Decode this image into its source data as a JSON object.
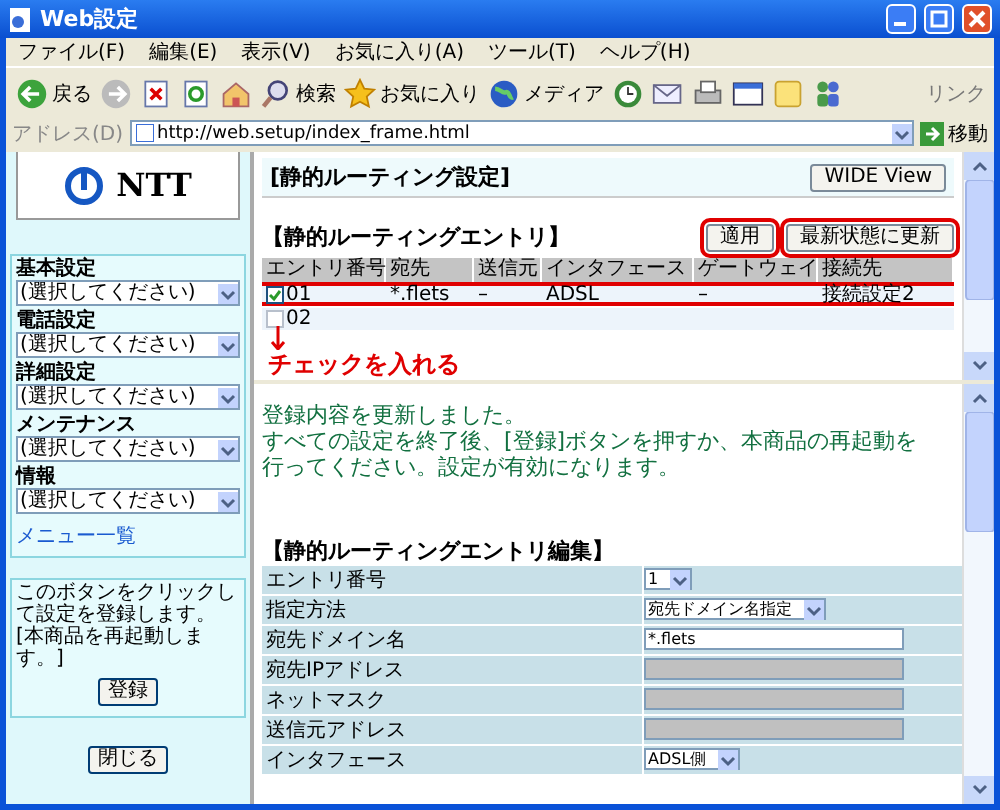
{
  "window": {
    "title": "Web設定"
  },
  "menu": [
    "ファイル(F)",
    "編集(E)",
    "表示(V)",
    "お気に入り(A)",
    "ツール(T)",
    "ヘルプ(H)"
  ],
  "toolbar": [
    {
      "kind": "back",
      "label": "戻る"
    },
    {
      "kind": "forward"
    },
    {
      "kind": "stop"
    },
    {
      "kind": "refresh"
    },
    {
      "kind": "home"
    },
    {
      "kind": "search",
      "label": "検索"
    },
    {
      "kind": "favorites",
      "label": "お気に入り"
    },
    {
      "kind": "media",
      "label": "メディア"
    },
    {
      "kind": "history"
    },
    {
      "kind": "mail"
    },
    {
      "kind": "print"
    },
    {
      "kind": "edit"
    },
    {
      "kind": "folder"
    },
    {
      "kind": "messenger"
    }
  ],
  "links_label": "リンク",
  "address": {
    "label": "アドレス(D)",
    "url": "http://web.setup/index_frame.html",
    "go": "移動"
  },
  "sidebar": {
    "logo": "NTT",
    "menus": [
      {
        "label": "基本設定",
        "value": "(選択してください)"
      },
      {
        "label": "電話設定",
        "value": "(選択してください)"
      },
      {
        "label": "詳細設定",
        "value": "(選択してください)"
      },
      {
        "label": "メンテナンス",
        "value": "(選択してください)"
      },
      {
        "label": "情報",
        "value": "(選択してください)"
      }
    ],
    "menu_link": "メニュー一覧",
    "note": "このボタンをクリックして設定を登録します。[本商品を再起動します。]",
    "register": "登録",
    "close": "閉じる"
  },
  "top": {
    "title": "[静的ルーティング設定]",
    "wide_button": "WIDE View",
    "entries_title": "【静的ルーティングエントリ】",
    "buttons": [
      {
        "label": "適用",
        "highlighted": true
      },
      {
        "label": "最新状態に更新",
        "highlighted": true
      }
    ],
    "columns": [
      "エントリ番号",
      "宛先",
      "送信元",
      "インタフェース",
      "ゲートウェイ",
      "接続先"
    ],
    "rows": [
      {
        "checked": true,
        "highlighted": true,
        "cells": [
          "01",
          "*.flets",
          "–",
          "ADSL",
          "–",
          "接続設定2"
        ]
      },
      {
        "checked": false,
        "highlighted": false,
        "cells": [
          "02",
          "",
          "",
          "",
          "",
          ""
        ]
      }
    ],
    "annotation": "チェックを入れる"
  },
  "bottom": {
    "message": [
      "登録内容を更新しました。",
      "すべての設定を終了後、[登録]ボタンを押すか、本商品の再起動を",
      "行ってください。設定が有効になります。"
    ],
    "edit_title": "【静的ルーティングエントリ編集】",
    "fields": [
      {
        "label": "エントリ番号",
        "kind": "select",
        "value": "1"
      },
      {
        "label": "指定方法",
        "kind": "select",
        "value": "宛先ドメイン名指定"
      },
      {
        "label": "宛先ドメイン名",
        "kind": "input",
        "value": "*.flets"
      },
      {
        "label": "宛先IPアドレス",
        "kind": "disabled"
      },
      {
        "label": "ネットマスク",
        "kind": "disabled"
      },
      {
        "label": "送信元アドレス",
        "kind": "disabled"
      },
      {
        "label": "インタフェース",
        "kind": "select",
        "value": "ADSL側"
      }
    ]
  }
}
